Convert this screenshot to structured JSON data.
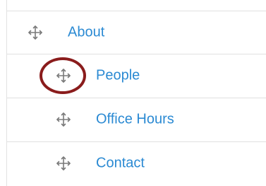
{
  "menu": {
    "items": [
      {
        "label": "About",
        "depth": 0
      },
      {
        "label": "People",
        "depth": 1
      },
      {
        "label": "Office Hours",
        "depth": 1
      },
      {
        "label": "Contact",
        "depth": 1
      }
    ]
  },
  "colors": {
    "link": "#2b8ad3",
    "handle": "#7a7a7a",
    "annotation": "#8a1c1c",
    "divider": "#e0e0e0"
  },
  "icons": {
    "drag": "move-arrows-icon",
    "annotation": "highlight-circle"
  }
}
